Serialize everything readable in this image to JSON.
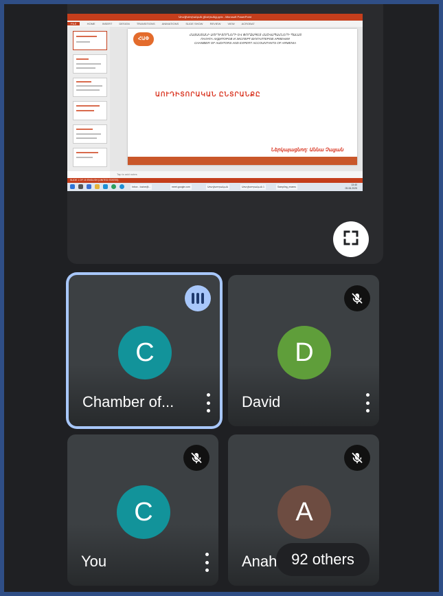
{
  "presentation": {
    "window_title": "Աուդիտորական ընտրանք.pptx - Microsoft PowerPoint",
    "ribbon_tabs": [
      "FILE",
      "HOME",
      "INSERT",
      "DESIGN",
      "TRANSITIONS",
      "ANIMATIONS",
      "SLIDE SHOW",
      "REVIEW",
      "VIEW",
      "ACROBAT"
    ],
    "slide_org_line1": "ՀԱՅԱՍՏԱՆԻ ԱՈՒԴԻՏՈՐՆԵՐԻ ԵՎ ՓՈՐՁԱԳԵՏ ՀԱՇՎԱՊԱՀՆԵՐԻ ՊԱԼԱՏ",
    "slide_org_line2": "ПАЛАТА АУДИТОРОВ И ЭКСПЕРТ БУХГАЛТЕРОВ АРМЕНИИ",
    "slide_org_line3": "CHAMBER OF AUDITORS AND EXPERT ACCOUNTANTS OF ARMENIA",
    "slide_logo_text": "ՀԱՓ",
    "slide_title": "ԱՈՒԴԻՏՈՐԱԿԱՆ ԸՆՏՐԱՆՔԸ",
    "slide_presenter": "Ներկայացնող: Աննա Չալյան",
    "notes_placeholder": "Tap to add notes",
    "status_text": "SLIDE 1 OF 15   ENGLISH (UNITED STATES)",
    "taskbar_items": [
      "Inbox - lusine@...",
      "meet.google.com",
      "Աուդիտորական",
      "Աուդիտորական 1",
      "Sampling_exams"
    ],
    "taskbar_time": "13:40",
    "taskbar_date": "05.06.2025"
  },
  "controls": {
    "fullscreen_icon": "fullscreen-icon"
  },
  "participants": [
    {
      "initial": "C",
      "name": "Chamber of...",
      "color": "#12939a",
      "status": "speaking"
    },
    {
      "initial": "D",
      "name": "David",
      "color": "#5f9e3a",
      "status": "muted"
    },
    {
      "initial": "C",
      "name": "You",
      "color": "#12939a",
      "status": "muted"
    },
    {
      "initial": "A",
      "name": "Anah",
      "color": "#6d4c41",
      "status": "muted"
    }
  ],
  "others_label": "92 others"
}
